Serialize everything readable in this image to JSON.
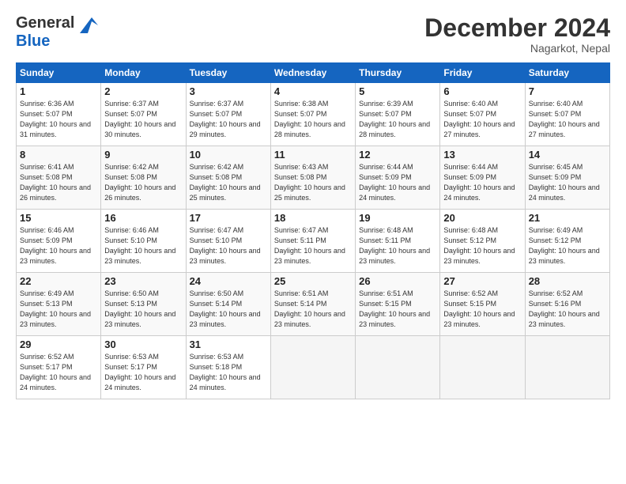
{
  "header": {
    "logo_general": "General",
    "logo_blue": "Blue",
    "title": "December 2024",
    "location": "Nagarkot, Nepal"
  },
  "days_of_week": [
    "Sunday",
    "Monday",
    "Tuesday",
    "Wednesday",
    "Thursday",
    "Friday",
    "Saturday"
  ],
  "weeks": [
    [
      {
        "day": "1",
        "sunrise": "Sunrise: 6:36 AM",
        "sunset": "Sunset: 5:07 PM",
        "daylight": "Daylight: 10 hours and 31 minutes."
      },
      {
        "day": "2",
        "sunrise": "Sunrise: 6:37 AM",
        "sunset": "Sunset: 5:07 PM",
        "daylight": "Daylight: 10 hours and 30 minutes."
      },
      {
        "day": "3",
        "sunrise": "Sunrise: 6:37 AM",
        "sunset": "Sunset: 5:07 PM",
        "daylight": "Daylight: 10 hours and 29 minutes."
      },
      {
        "day": "4",
        "sunrise": "Sunrise: 6:38 AM",
        "sunset": "Sunset: 5:07 PM",
        "daylight": "Daylight: 10 hours and 28 minutes."
      },
      {
        "day": "5",
        "sunrise": "Sunrise: 6:39 AM",
        "sunset": "Sunset: 5:07 PM",
        "daylight": "Daylight: 10 hours and 28 minutes."
      },
      {
        "day": "6",
        "sunrise": "Sunrise: 6:40 AM",
        "sunset": "Sunset: 5:07 PM",
        "daylight": "Daylight: 10 hours and 27 minutes."
      },
      {
        "day": "7",
        "sunrise": "Sunrise: 6:40 AM",
        "sunset": "Sunset: 5:07 PM",
        "daylight": "Daylight: 10 hours and 27 minutes."
      }
    ],
    [
      {
        "day": "8",
        "sunrise": "Sunrise: 6:41 AM",
        "sunset": "Sunset: 5:08 PM",
        "daylight": "Daylight: 10 hours and 26 minutes."
      },
      {
        "day": "9",
        "sunrise": "Sunrise: 6:42 AM",
        "sunset": "Sunset: 5:08 PM",
        "daylight": "Daylight: 10 hours and 26 minutes."
      },
      {
        "day": "10",
        "sunrise": "Sunrise: 6:42 AM",
        "sunset": "Sunset: 5:08 PM",
        "daylight": "Daylight: 10 hours and 25 minutes."
      },
      {
        "day": "11",
        "sunrise": "Sunrise: 6:43 AM",
        "sunset": "Sunset: 5:08 PM",
        "daylight": "Daylight: 10 hours and 25 minutes."
      },
      {
        "day": "12",
        "sunrise": "Sunrise: 6:44 AM",
        "sunset": "Sunset: 5:09 PM",
        "daylight": "Daylight: 10 hours and 24 minutes."
      },
      {
        "day": "13",
        "sunrise": "Sunrise: 6:44 AM",
        "sunset": "Sunset: 5:09 PM",
        "daylight": "Daylight: 10 hours and 24 minutes."
      },
      {
        "day": "14",
        "sunrise": "Sunrise: 6:45 AM",
        "sunset": "Sunset: 5:09 PM",
        "daylight": "Daylight: 10 hours and 24 minutes."
      }
    ],
    [
      {
        "day": "15",
        "sunrise": "Sunrise: 6:46 AM",
        "sunset": "Sunset: 5:09 PM",
        "daylight": "Daylight: 10 hours and 23 minutes."
      },
      {
        "day": "16",
        "sunrise": "Sunrise: 6:46 AM",
        "sunset": "Sunset: 5:10 PM",
        "daylight": "Daylight: 10 hours and 23 minutes."
      },
      {
        "day": "17",
        "sunrise": "Sunrise: 6:47 AM",
        "sunset": "Sunset: 5:10 PM",
        "daylight": "Daylight: 10 hours and 23 minutes."
      },
      {
        "day": "18",
        "sunrise": "Sunrise: 6:47 AM",
        "sunset": "Sunset: 5:11 PM",
        "daylight": "Daylight: 10 hours and 23 minutes."
      },
      {
        "day": "19",
        "sunrise": "Sunrise: 6:48 AM",
        "sunset": "Sunset: 5:11 PM",
        "daylight": "Daylight: 10 hours and 23 minutes."
      },
      {
        "day": "20",
        "sunrise": "Sunrise: 6:48 AM",
        "sunset": "Sunset: 5:12 PM",
        "daylight": "Daylight: 10 hours and 23 minutes."
      },
      {
        "day": "21",
        "sunrise": "Sunrise: 6:49 AM",
        "sunset": "Sunset: 5:12 PM",
        "daylight": "Daylight: 10 hours and 23 minutes."
      }
    ],
    [
      {
        "day": "22",
        "sunrise": "Sunrise: 6:49 AM",
        "sunset": "Sunset: 5:13 PM",
        "daylight": "Daylight: 10 hours and 23 minutes."
      },
      {
        "day": "23",
        "sunrise": "Sunrise: 6:50 AM",
        "sunset": "Sunset: 5:13 PM",
        "daylight": "Daylight: 10 hours and 23 minutes."
      },
      {
        "day": "24",
        "sunrise": "Sunrise: 6:50 AM",
        "sunset": "Sunset: 5:14 PM",
        "daylight": "Daylight: 10 hours and 23 minutes."
      },
      {
        "day": "25",
        "sunrise": "Sunrise: 6:51 AM",
        "sunset": "Sunset: 5:14 PM",
        "daylight": "Daylight: 10 hours and 23 minutes."
      },
      {
        "day": "26",
        "sunrise": "Sunrise: 6:51 AM",
        "sunset": "Sunset: 5:15 PM",
        "daylight": "Daylight: 10 hours and 23 minutes."
      },
      {
        "day": "27",
        "sunrise": "Sunrise: 6:52 AM",
        "sunset": "Sunset: 5:15 PM",
        "daylight": "Daylight: 10 hours and 23 minutes."
      },
      {
        "day": "28",
        "sunrise": "Sunrise: 6:52 AM",
        "sunset": "Sunset: 5:16 PM",
        "daylight": "Daylight: 10 hours and 23 minutes."
      }
    ],
    [
      {
        "day": "29",
        "sunrise": "Sunrise: 6:52 AM",
        "sunset": "Sunset: 5:17 PM",
        "daylight": "Daylight: 10 hours and 24 minutes."
      },
      {
        "day": "30",
        "sunrise": "Sunrise: 6:53 AM",
        "sunset": "Sunset: 5:17 PM",
        "daylight": "Daylight: 10 hours and 24 minutes."
      },
      {
        "day": "31",
        "sunrise": "Sunrise: 6:53 AM",
        "sunset": "Sunset: 5:18 PM",
        "daylight": "Daylight: 10 hours and 24 minutes."
      },
      {
        "day": "",
        "sunrise": "",
        "sunset": "",
        "daylight": ""
      },
      {
        "day": "",
        "sunrise": "",
        "sunset": "",
        "daylight": ""
      },
      {
        "day": "",
        "sunrise": "",
        "sunset": "",
        "daylight": ""
      },
      {
        "day": "",
        "sunrise": "",
        "sunset": "",
        "daylight": ""
      }
    ]
  ]
}
